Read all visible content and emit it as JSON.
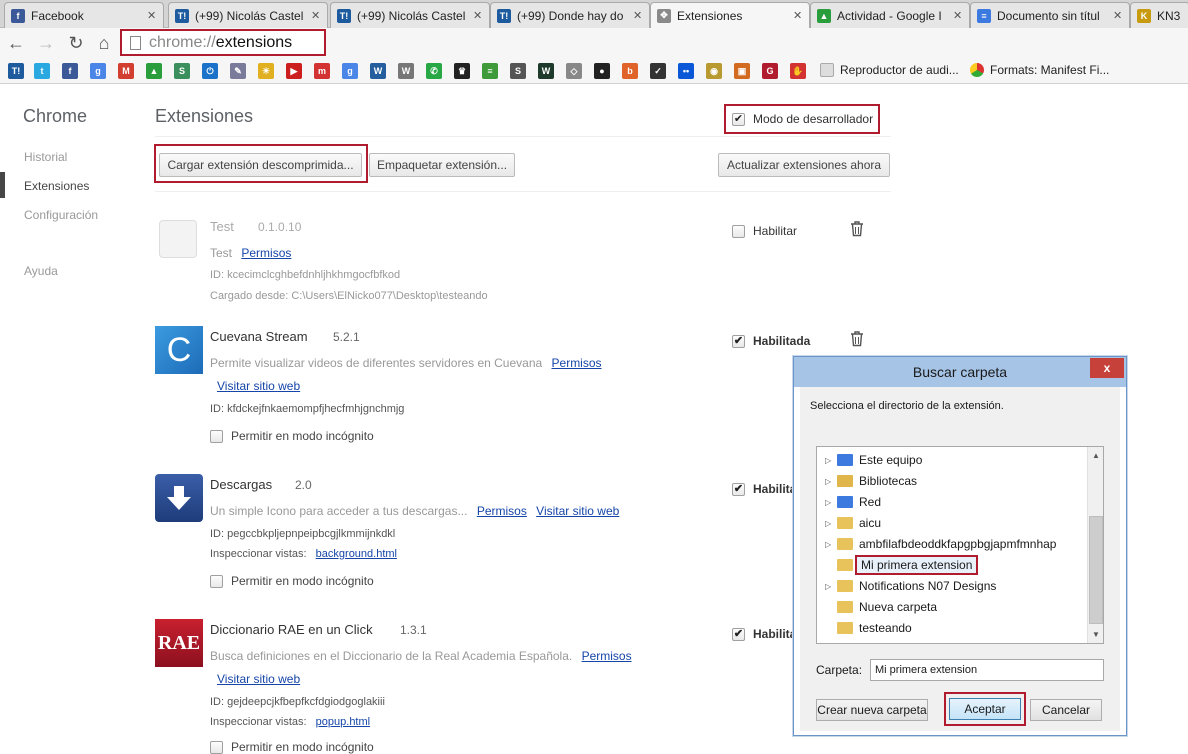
{
  "tabs": [
    {
      "title": "Facebook",
      "icon": "facebook-icon",
      "color": "#3b5998",
      "glyph": "f"
    },
    {
      "title": "(+99) Nicolás Castel",
      "icon": "taringa-icon",
      "color": "#1d5a9e",
      "glyph": "T!"
    },
    {
      "title": "(+99) Nicolás Castel",
      "icon": "taringa-icon",
      "color": "#1d5a9e",
      "glyph": "T!"
    },
    {
      "title": "(+99) Donde hay do",
      "icon": "taringa-icon",
      "color": "#1d5a9e",
      "glyph": "T!"
    },
    {
      "title": "Extensiones",
      "icon": "puzzle-icon",
      "color": "#7a7a7a",
      "glyph": "✥"
    },
    {
      "title": "Actividad - Google I",
      "icon": "google-drive-icon",
      "color": "#2a9d3d",
      "glyph": "▲"
    },
    {
      "title": "Documento sin títul",
      "icon": "google-docs-icon",
      "color": "#3d7ae0",
      "glyph": "≡"
    },
    {
      "title": "KN3 -",
      "icon": "kn3-icon",
      "color": "#c89a10",
      "glyph": "K"
    }
  ],
  "address": {
    "scheme": "chrome://",
    "path": "extensions"
  },
  "bookmarks": {
    "icons": [
      {
        "name": "taringa-icon",
        "color": "#1d5a9e",
        "glyph": "T!"
      },
      {
        "name": "twitter-icon",
        "color": "#2aa9e0",
        "glyph": "t"
      },
      {
        "name": "facebook-icon",
        "color": "#3b5998",
        "glyph": "f"
      },
      {
        "name": "google-plus-icon",
        "color": "#4a86e8",
        "glyph": "g"
      },
      {
        "name": "gmail-icon",
        "color": "#d23f31",
        "glyph": "M"
      },
      {
        "name": "google-drive-icon",
        "color": "#2a9d3d",
        "glyph": "▲"
      },
      {
        "name": "google-sites-icon",
        "color": "#3a8f5c",
        "glyph": "S"
      },
      {
        "name": "power-icon",
        "color": "#1a73c9",
        "glyph": "⏻"
      },
      {
        "name": "feather-icon",
        "color": "#7a7a9a",
        "glyph": "✎"
      },
      {
        "name": "sun-icon",
        "color": "#e0b020",
        "glyph": "☀"
      },
      {
        "name": "youtube-icon",
        "color": "#cc1e1e",
        "glyph": "▶"
      },
      {
        "name": "mega-icon",
        "color": "#d23232",
        "glyph": "m"
      },
      {
        "name": "google-plus-icon",
        "color": "#4a86e8",
        "glyph": "g"
      },
      {
        "name": "w3-icon",
        "color": "#255e9e",
        "glyph": "W"
      },
      {
        "name": "wordpress-icon",
        "color": "#777",
        "glyph": "W"
      },
      {
        "name": "whatsapp-icon",
        "color": "#28a745",
        "glyph": "✆"
      },
      {
        "name": "chess-icon",
        "color": "#222",
        "glyph": "♛"
      },
      {
        "name": "stack-icon",
        "color": "#3f9a3a",
        "glyph": "≡"
      },
      {
        "name": "s-icon",
        "color": "#555",
        "glyph": "S"
      },
      {
        "name": "w-icon",
        "color": "#1e3a2a",
        "glyph": "W"
      },
      {
        "name": "codepen-icon",
        "color": "#888",
        "glyph": "◇"
      },
      {
        "name": "github-icon",
        "color": "#222",
        "glyph": "●"
      },
      {
        "name": "bitly-icon",
        "color": "#e0642a",
        "glyph": "b"
      },
      {
        "name": "check-icon",
        "color": "#333",
        "glyph": "✓"
      },
      {
        "name": "flickr-icon",
        "color": "#0a58d8",
        "glyph": "••"
      },
      {
        "name": "eye-icon",
        "color": "#b89a30",
        "glyph": "◉"
      },
      {
        "name": "photo-icon",
        "color": "#d26a20",
        "glyph": "▣"
      },
      {
        "name": "mail-icon",
        "color": "#b01c2e",
        "glyph": "G"
      },
      {
        "name": "hand-icon",
        "color": "#d23232",
        "glyph": "✋"
      }
    ],
    "items": [
      {
        "label": "Reproductor de audi...",
        "icon": "audio-player-icon"
      },
      {
        "label": "Formats: Manifest Fi...",
        "icon": "chrome-icon"
      }
    ]
  },
  "sidebar": {
    "title": "Chrome",
    "items": [
      {
        "label": "Historial"
      },
      {
        "label": "Extensiones"
      },
      {
        "label": "Configuración"
      },
      {
        "label": "Ayuda"
      }
    ]
  },
  "page": {
    "heading": "Extensiones",
    "dev_mode_label": "Modo de desarrollador",
    "dev_mode_checked": true,
    "btn_load": "Cargar extensión descomprimida...",
    "btn_pack": "Empaquetar extensión...",
    "btn_update": "Actualizar extensiones ahora"
  },
  "extensions": [
    {
      "name": "Test",
      "version": "0.1.0.10",
      "desc": "Test",
      "link_perms": "Permisos",
      "id_line": "ID: kcecimclcghbefdnhljhkhmgocfbfkod",
      "loaded_from": "Cargado desde: C:\\Users\\ElNicko077\\Desktop\\testeando",
      "enable_label": "Habilitar",
      "enabled": false
    },
    {
      "name": "Cuevana Stream",
      "version": "5.2.1",
      "desc": "Permite visualizar videos de diferentes servidores en Cuevana",
      "link_perms": "Permisos",
      "link_site": "Visitar sitio web",
      "id_line": "ID: kfdckejfnkaemompfjhecfmhjgnchmjg",
      "incognito_label": "Permitir en modo incógnito",
      "enable_label": "Habilitada",
      "enabled": true
    },
    {
      "name": "Descargas",
      "version": "2.0",
      "desc": "Un simple Icono para acceder a tus descargas...",
      "link_perms": "Permisos",
      "link_site": "Visitar sitio web",
      "id_line": "ID: pegccbkpljepnpeipbcgjlkmmijnkdkl",
      "inspect_label": "Inspeccionar vistas:",
      "inspect_link": "background.html",
      "incognito_label": "Permitir en modo incógnito",
      "enable_label": "Habilita",
      "enabled": true
    },
    {
      "name": "Diccionario RAE en un Click",
      "version": "1.3.1",
      "desc": "Busca definiciones en el Diccionario de la Real Academia Española.",
      "link_perms": "Permisos",
      "link_site": "Visitar sitio web",
      "id_line": "ID: gejdeepcjkfbepfkcfdgiodgoglakiii",
      "inspect_label": "Inspeccionar vistas:",
      "inspect_link": "popup.html",
      "incognito_label": "Permitir en modo incógnito",
      "enable_label": "Habilita",
      "enabled": true
    }
  ],
  "dialog": {
    "title": "Buscar carpeta",
    "close": "x",
    "instruction": "Selecciona el directorio de la extensión.",
    "tree": [
      {
        "label": "Este equipo",
        "icon": "computer-icon",
        "expand": true
      },
      {
        "label": "Bibliotecas",
        "icon": "library-icon",
        "expand": true
      },
      {
        "label": "Red",
        "icon": "network-icon",
        "expand": true
      },
      {
        "label": "aicu",
        "icon": "folder-icon",
        "expand": true
      },
      {
        "label": "ambfilafbdeoddkfapgpbgjapmfmnhap",
        "icon": "folder-icon",
        "expand": true
      },
      {
        "label": "Mi primera extension",
        "icon": "folder-icon",
        "expand": false,
        "selected": true
      },
      {
        "label": "Notifications N07 Designs",
        "icon": "folder-icon",
        "expand": true
      },
      {
        "label": "Nueva carpeta",
        "icon": "folder-icon",
        "expand": false
      },
      {
        "label": "testeando",
        "icon": "folder-icon",
        "expand": false
      }
    ],
    "folder_label": "Carpeta:",
    "folder_value": "Mi primera extension",
    "btn_new": "Crear nueva carpeta",
    "btn_ok": "Aceptar",
    "btn_cancel": "Cancelar"
  },
  "colors": {
    "highlight_red": "#b01c2e",
    "link": "#1545a8",
    "dialog_title": "#a6c4e6"
  }
}
